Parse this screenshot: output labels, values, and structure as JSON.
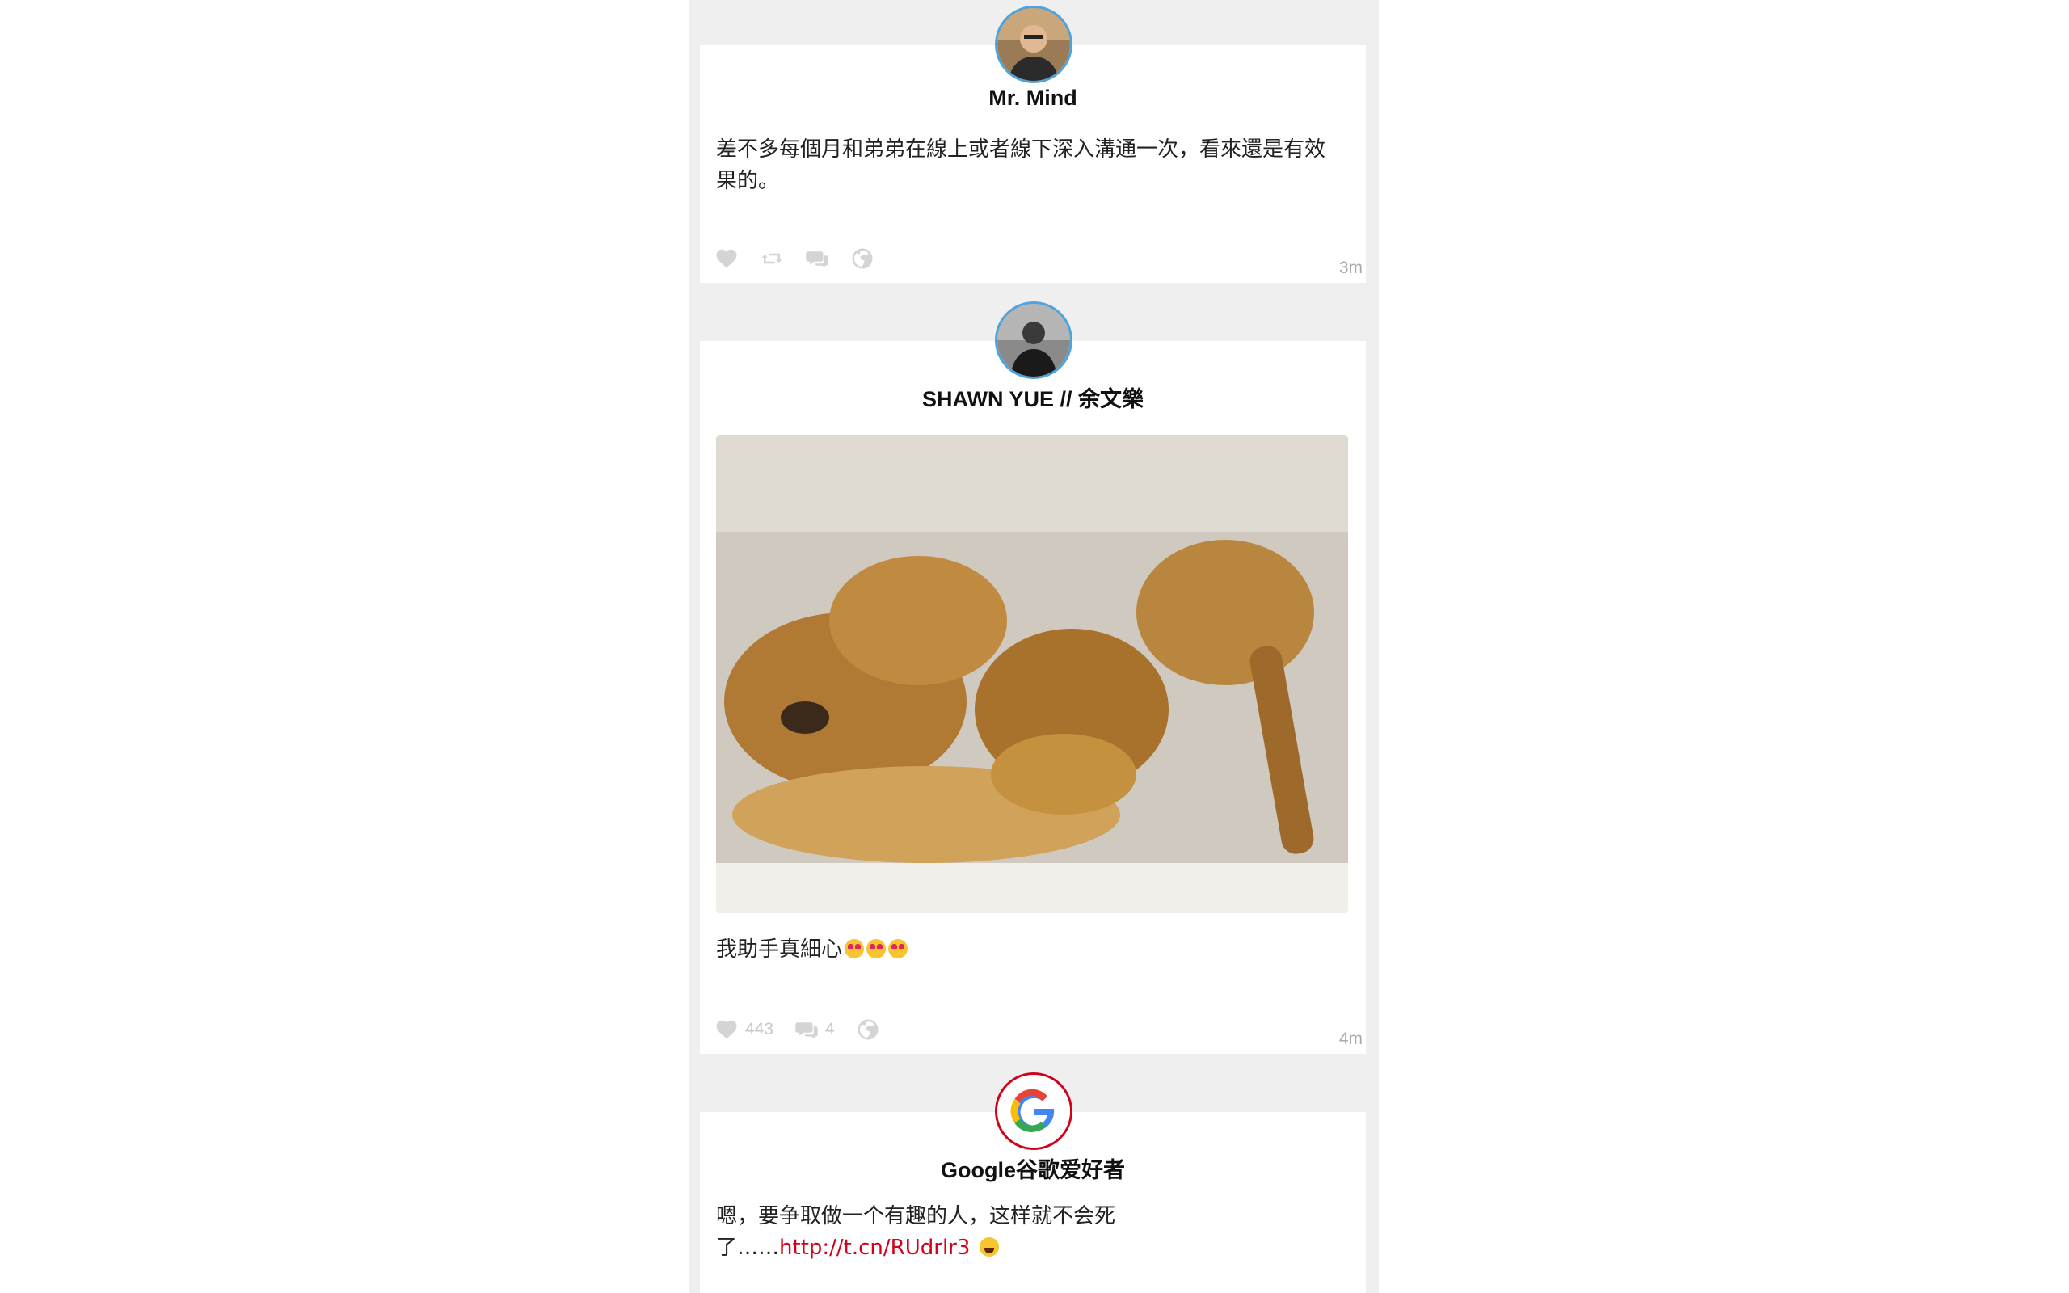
{
  "posts": [
    {
      "author": "Mr. Mind",
      "avatar": "profile-photo",
      "text": "差不多每個月和弟弟在線上或者線下深入溝通一次，看來還是有效果的。",
      "actions": [
        "heart-icon",
        "retweet-icon",
        "comment-icon",
        "globe-icon"
      ],
      "time": "3m"
    },
    {
      "author": "SHAWN YUE // 余文樂",
      "avatar": "profile-photo",
      "image": "fried-chicken-photo",
      "text": "我助手真細心",
      "emoji": [
        "smiling-face-with-heart-eyes",
        "smiling-face-with-heart-eyes",
        "smiling-face-with-heart-eyes"
      ],
      "likes": "443",
      "comments": "4",
      "time": "4m"
    },
    {
      "author": "Google谷歌爱好者",
      "avatar": "google-logo",
      "text_before_link": "嗯，要争取做一个有趣的人，这样就不会死了……",
      "link": "http://t.cn/RUdrlr3",
      "emoji": [
        "laughing-face"
      ]
    }
  ],
  "colors": {
    "feed_background": "#efefef",
    "card_background": "#ffffff",
    "avatar_ring": "#4fa3dc",
    "link": "#d0021b",
    "icon": "#d4d4d4"
  }
}
